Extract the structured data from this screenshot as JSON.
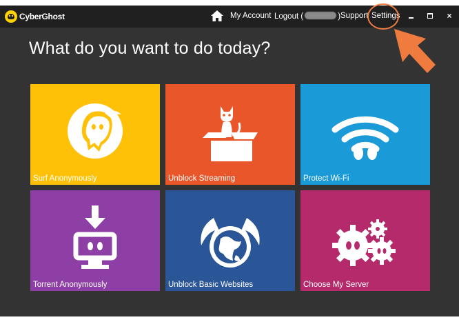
{
  "app": {
    "name": "CyberGhost"
  },
  "nav": {
    "my_account": "My Account",
    "logout_prefix": "Logout (",
    "logout_suffix": ")",
    "support": "Support",
    "settings": "Settings"
  },
  "window_controls": {
    "close": "×"
  },
  "heading": "What do you want to do today?",
  "tiles": [
    {
      "label": "Surf Anonymously",
      "color": "#ffc107",
      "icon": "ghost-icon"
    },
    {
      "label": "Unblock Streaming",
      "color": "#e8562a",
      "icon": "cat-in-box-icon"
    },
    {
      "label": "Protect Wi-Fi",
      "color": "#1b9ad8",
      "icon": "wifi-icon"
    },
    {
      "label": "Torrent Anonymously",
      "color": "#8e3fa6",
      "icon": "download-monitor-icon"
    },
    {
      "label": "Unblock Basic Websites",
      "color": "#2a5597",
      "icon": "winged-globe-icon"
    },
    {
      "label": "Choose My Server",
      "color": "#b52a6a",
      "icon": "gears-icon"
    }
  ],
  "colors": {
    "titlebar": "#202020",
    "window": "#333333",
    "annotation": "#f07b3e"
  }
}
